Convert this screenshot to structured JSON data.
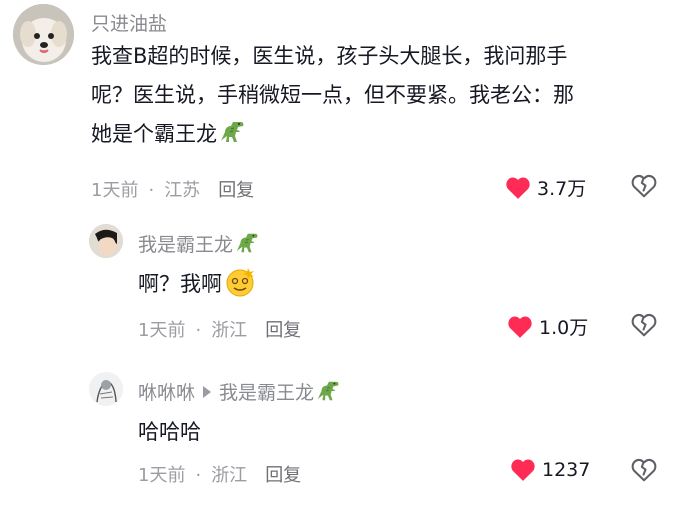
{
  "comments": [
    {
      "username": "只进油盐",
      "lines": [
        "我查B超的时候，医生说，孩子头大腿长，我问那手",
        "呢？医生说，手稍微短一点，但不要紧。我老公：那",
        "她是个霸王龙"
      ],
      "time": "1天前",
      "location": "江苏",
      "reply_label": "回复",
      "likes": "3.7万"
    },
    {
      "username": "我是霸王龙",
      "text": "啊？我啊",
      "time": "1天前",
      "location": "浙江",
      "reply_label": "回复",
      "likes": "1.0万"
    },
    {
      "username": "咻咻咻",
      "reply_to": "我是霸王龙",
      "text": "哈哈哈",
      "time": "1天前",
      "location": "浙江",
      "reply_label": "回复",
      "likes": "1237"
    }
  ],
  "icons": {
    "like": "heart-filled-icon",
    "dislike": "heart-broken-icon",
    "dino": "t-rex-emoji",
    "dizzy": "dizzy-face-emoji"
  },
  "colors": {
    "like_red": "#fe2c55",
    "username_gray": "#8a8b91",
    "meta_gray": "#9c9da3"
  }
}
